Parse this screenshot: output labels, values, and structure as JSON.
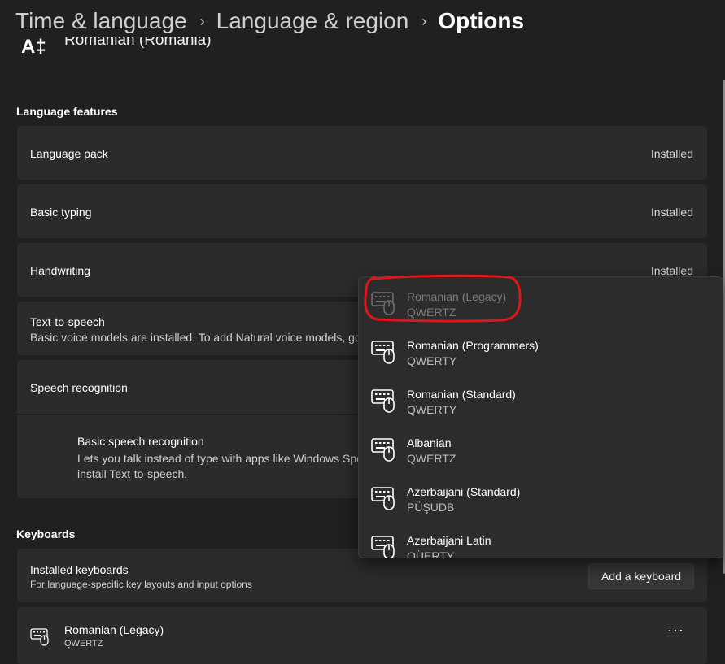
{
  "breadcrumb": {
    "items": [
      "Time & language",
      "Language & region",
      "Options"
    ],
    "separator": "›"
  },
  "language": {
    "icon_glyph": "A‡",
    "name": "Romanian (Romania)"
  },
  "language_features": {
    "title": "Language features",
    "items": [
      {
        "label": "Language pack",
        "status": "Installed"
      },
      {
        "label": "Basic typing",
        "status": "Installed"
      },
      {
        "label": "Handwriting",
        "status": "Installed"
      },
      {
        "label": "Text-to-speech",
        "description": "Basic voice models are installed. To add Natural voice models, go"
      },
      {
        "label": "Speech recognition"
      }
    ],
    "speech_sub": {
      "label": "Basic speech recognition",
      "description_line1": "Lets you talk instead of type with apps like Windows Spe",
      "description_line2": "install Text-to-speech."
    }
  },
  "keyboards": {
    "title": "Keyboards",
    "installed_label": "Installed keyboards",
    "installed_desc": "For language-specific key layouts and input options",
    "add_button": "Add a keyboard",
    "installed_list": [
      {
        "name": "Romanian (Legacy)",
        "layout": "QWERTZ"
      }
    ],
    "more_glyph": "···"
  },
  "dropdown": {
    "items": [
      {
        "name": "Romanian (Legacy)",
        "layout": "QWERTZ",
        "disabled": true
      },
      {
        "name": "Romanian (Programmers)",
        "layout": "QWERTY"
      },
      {
        "name": "Romanian (Standard)",
        "layout": "QWERTY"
      },
      {
        "name": "Albanian",
        "layout": "QWERTZ"
      },
      {
        "name": "Azerbaijani (Standard)",
        "layout": "PÜŞUDB"
      },
      {
        "name": "Azerbaijani Latin",
        "layout": "QÜERTY"
      }
    ]
  },
  "colors": {
    "background": "#202020",
    "card": "#2b2b2b",
    "annotation_red": "#e0161a"
  }
}
